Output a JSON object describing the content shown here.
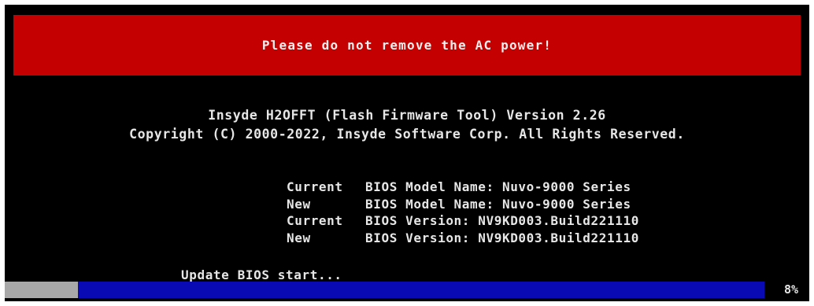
{
  "warning": {
    "text": "Please do not remove the AC power!"
  },
  "tool": {
    "title": "Insyde H2OFFT (Flash Firmware Tool) Version 2.26",
    "copyright": "Copyright (C) 2000-2022, Insyde Software Corp. All Rights Reserved."
  },
  "bios_info": [
    {
      "label_a": "Current",
      "label_b": "BIOS Model Name:",
      "value": "Nuvo-9000 Series"
    },
    {
      "label_a": "New",
      "label_b": "BIOS Model Name:",
      "value": "Nuvo-9000 Series"
    },
    {
      "label_a": "Current",
      "label_b": "BIOS Version:",
      "value": "NV9KD003.Build221110"
    },
    {
      "label_a": "New",
      "label_b": "BIOS Version:",
      "value": "NV9KD003.Build221110"
    }
  ],
  "status": {
    "text": "Update BIOS start..."
  },
  "progress": {
    "fraction": 0.08,
    "percent_label": "8%",
    "bar_color": "#0a0ab4",
    "fill_color": "#a8a8a8"
  },
  "colors": {
    "screen_bg": "#000000",
    "banner_bg": "#c40000",
    "text": "#e6e6e6"
  }
}
